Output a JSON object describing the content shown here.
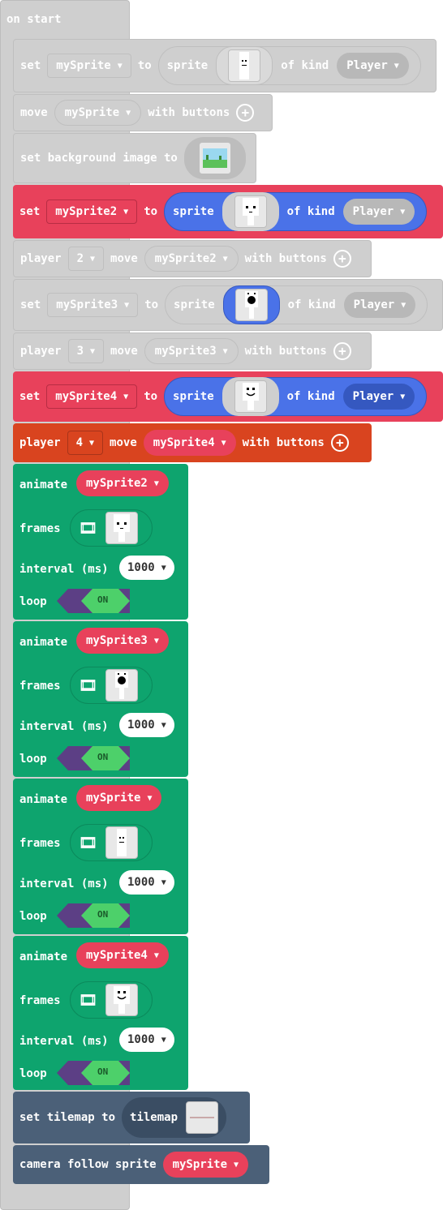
{
  "on_start": {
    "label": "on start"
  },
  "b1": {
    "set": "set",
    "var": "mySprite",
    "to": "to",
    "sprite": "sprite",
    "of_kind": "of kind",
    "kind": "Player"
  },
  "b2": {
    "move": "move",
    "var": "mySprite",
    "with_buttons": "with buttons"
  },
  "b3": {
    "label": "set background image to"
  },
  "b4": {
    "set": "set",
    "var": "mySprite2",
    "to": "to",
    "sprite": "sprite",
    "of_kind": "of kind",
    "kind": "Player"
  },
  "b5": {
    "player": "player",
    "num": "2",
    "move": "move",
    "var": "mySprite2",
    "with_buttons": "with buttons"
  },
  "b6": {
    "set": "set",
    "var": "mySprite3",
    "to": "to",
    "sprite": "sprite",
    "of_kind": "of kind",
    "kind": "Player"
  },
  "b7": {
    "player": "player",
    "num": "3",
    "move": "move",
    "var": "mySprite3",
    "with_buttons": "with buttons"
  },
  "b8": {
    "set": "set",
    "var": "mySprite4",
    "to": "to",
    "sprite": "sprite",
    "of_kind": "of kind",
    "kind": "Player"
  },
  "b9": {
    "player": "player",
    "num": "4",
    "move": "move",
    "var": "mySprite4",
    "with_buttons": "with buttons"
  },
  "animate_label": "animate",
  "frames_label": "frames",
  "interval_label": "interval (ms)",
  "loop_label": "loop",
  "anims": [
    {
      "var": "mySprite2",
      "interval": "1000",
      "loop": "ON"
    },
    {
      "var": "mySprite3",
      "interval": "1000",
      "loop": "ON"
    },
    {
      "var": "mySprite",
      "interval": "1000",
      "loop": "ON"
    },
    {
      "var": "mySprite4",
      "interval": "1000",
      "loop": "ON"
    }
  ],
  "tilemap": {
    "label": "set tilemap to",
    "value": "tilemap"
  },
  "camera": {
    "label": "camera follow sprite",
    "var": "mySprite"
  },
  "colors": {
    "red": "#e8415b",
    "blue": "#4a72e8",
    "orange": "#d9441f",
    "green": "#0ea46e",
    "slate": "#4b6078",
    "purple": "#5c3f85",
    "toggle_on": "#4dd06a",
    "disabled": "#cfcfcf"
  }
}
